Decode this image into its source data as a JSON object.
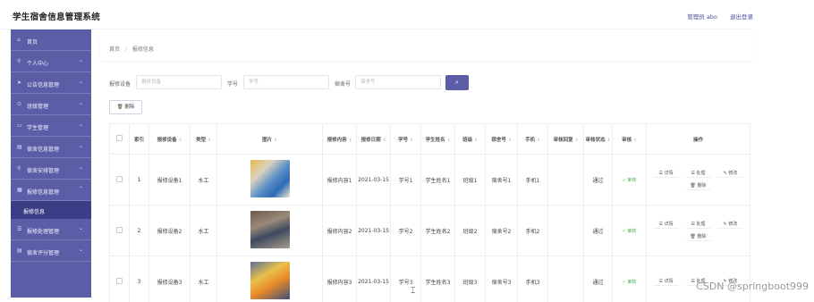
{
  "app": {
    "title": "学生宿舍信息管理系统"
  },
  "header": {
    "user_label": "管理员 abo",
    "logout_label": "退出登录"
  },
  "sidebar": {
    "items": [
      {
        "label": "首页",
        "icon": "home-icon",
        "chevron": ""
      },
      {
        "label": "个人中心",
        "icon": "person-icon",
        "chevron": "⌄"
      },
      {
        "label": "公告信息管理",
        "icon": "send-icon",
        "chevron": "⌄"
      },
      {
        "label": "班级管理",
        "icon": "pin-icon",
        "chevron": "⌄"
      },
      {
        "label": "学生管理",
        "icon": "chat-icon",
        "chevron": "⌄"
      },
      {
        "label": "宿舍信息管理",
        "icon": "building-icon",
        "chevron": "⌄"
      },
      {
        "label": "宿舍安排管理",
        "icon": "person-icon",
        "chevron": "⌄"
      },
      {
        "label": "报修信息管理",
        "icon": "grid-icon",
        "chevron": "⌃"
      },
      {
        "label": "报修处理管理",
        "icon": "list-icon",
        "chevron": "⌄"
      },
      {
        "label": "宿舍评分管理",
        "icon": "building-icon",
        "chevron": "⌄"
      }
    ],
    "active_sub": "报修信息"
  },
  "breadcrumb": {
    "home": "首页",
    "separator": "/",
    "current": "报修信息"
  },
  "search": {
    "device_label": "报修设备",
    "device_placeholder": "报修设备",
    "student_label": "学号",
    "student_placeholder": "学号",
    "dorm_label": "宿舍号",
    "dorm_placeholder": "宿舍号",
    "button_icon": "search-icon"
  },
  "toolbar": {
    "delete_label": "🗑 删除"
  },
  "table": {
    "headers": [
      "",
      "索引",
      "报修设备",
      "类型",
      "图片",
      "报修内容",
      "报修日期",
      "学号",
      "学生姓名",
      "班级",
      "宿舍号",
      "手机",
      "审核回复",
      "审核状态",
      "审核",
      "操作"
    ],
    "rows": [
      {
        "index": "1",
        "device": "报修设备1",
        "type": "水工",
        "content": "报修内容1",
        "date": "2021-03-15",
        "student_id": "学号1",
        "name": "学生姓名1",
        "class": "班级1",
        "dorm": "宿舍号1",
        "phone": "手机1",
        "reply": "",
        "status": "通过",
        "audit": "✓ 审核"
      },
      {
        "index": "2",
        "device": "报修设备2",
        "type": "水工",
        "content": "报修内容2",
        "date": "2021-03-15",
        "student_id": "学号2",
        "name": "学生姓名2",
        "class": "班级2",
        "dorm": "宿舍号2",
        "phone": "手机2",
        "reply": "",
        "status": "通过",
        "audit": "✓ 审核"
      },
      {
        "index": "3",
        "device": "报修设备3",
        "type": "水工",
        "content": "报修内容3",
        "date": "2021-03-15",
        "student_id": "学号3",
        "name": "学生姓名3",
        "class": "班级3",
        "dorm": "宿舍号3",
        "phone": "手机3",
        "reply": "",
        "status": "通过",
        "audit": "✓ 审核"
      }
    ],
    "ops": {
      "detail": "☰ 详情",
      "handle": "☰ 处理",
      "edit": "✎ 修改",
      "delete": "🗑 删除"
    }
  },
  "watermark": "CSDN @springboot999",
  "colors": {
    "accent": "#5b5ea6",
    "sidebar_active": "#3b3d86",
    "approve": "#4caf50"
  }
}
